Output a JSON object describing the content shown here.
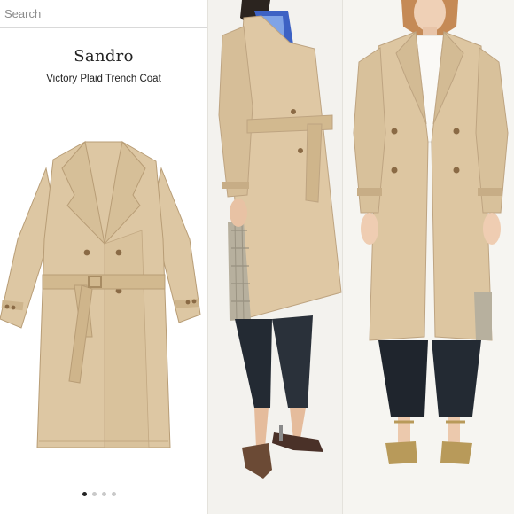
{
  "search": {
    "placeholder": "Search"
  },
  "product": {
    "brand": "Sandro",
    "name": "Victory Plaid Trench Coat"
  },
  "carousel_left": {
    "count": 4,
    "active": 0
  },
  "carousel_right": {
    "count": 4,
    "active": 1
  },
  "colors": {
    "coat": "#ddc7a3",
    "coat_shadow": "#c9b08a",
    "plaid": "#b7b09e",
    "trousers": "#232a33"
  }
}
